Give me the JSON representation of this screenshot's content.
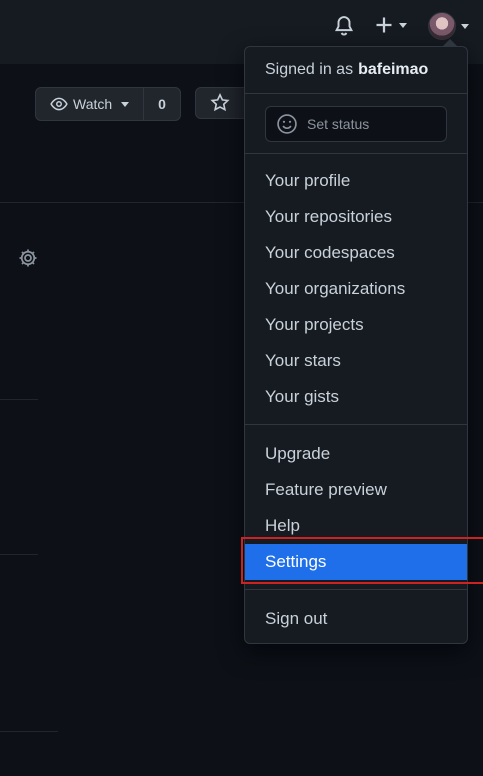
{
  "header": {
    "notifications_icon": "bell-icon",
    "create_icon": "plus-icon",
    "avatar_icon": "user-avatar"
  },
  "repo": {
    "watch_label": "Watch",
    "watch_count": "0",
    "star_icon": "star-icon"
  },
  "dropdown": {
    "signed_in_prefix": "Signed in as",
    "username": "bafeimao",
    "status_placeholder": "Set status",
    "group1": [
      "Your profile",
      "Your repositories",
      "Your codespaces",
      "Your organizations",
      "Your projects",
      "Your stars",
      "Your gists"
    ],
    "group2": [
      "Upgrade",
      "Feature preview",
      "Help",
      "Settings"
    ],
    "sign_out": "Sign out",
    "active_item": "Settings"
  },
  "colors": {
    "background": "#0d1117",
    "header": "#161b22",
    "accent": "#1f6feb",
    "highlight_border": "#cc2222"
  }
}
